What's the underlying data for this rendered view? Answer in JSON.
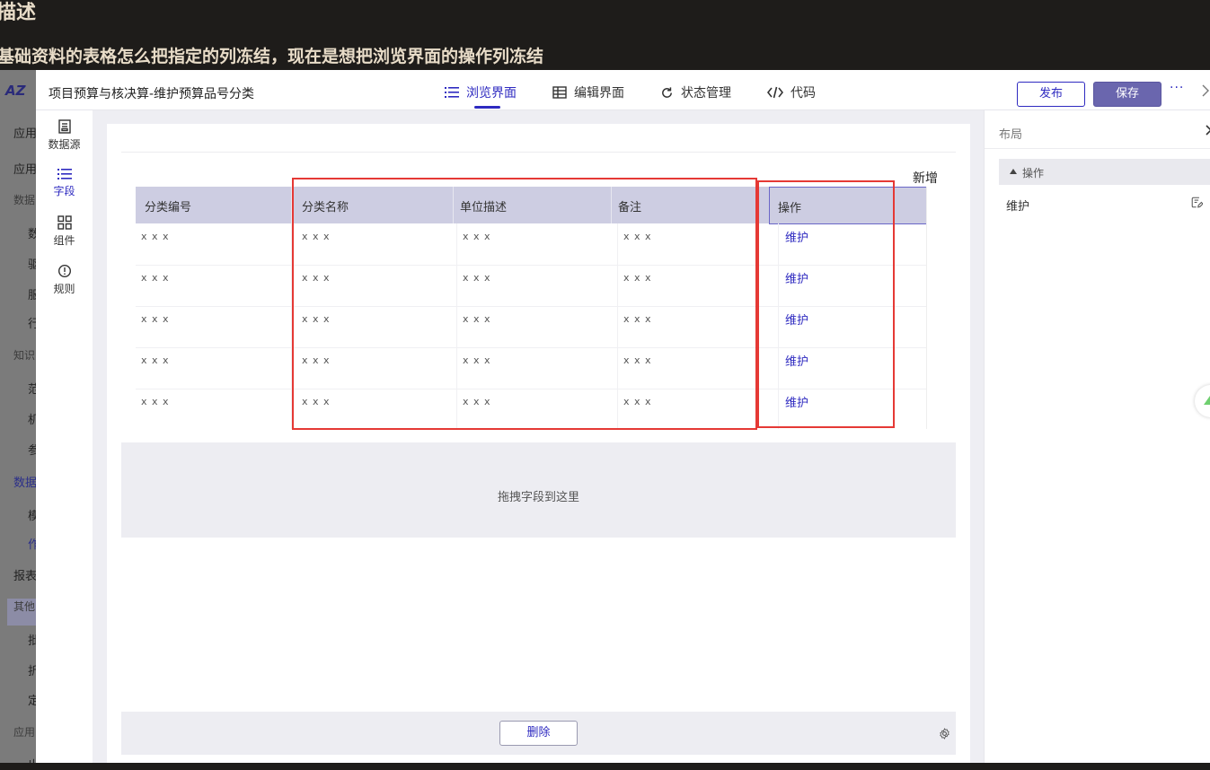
{
  "question": {
    "title": "描述",
    "body": "基础资料的表格怎么把指定的列冻结，现在是想把浏览界面的操作列冻结"
  },
  "background_sidebar": {
    "logo": "AZ",
    "items": [
      "应用",
      "应用",
      "数据",
      "数",
      "驱",
      "服",
      "行",
      "知识",
      "范",
      "机",
      "参",
      "数据",
      "模",
      "作",
      "报表",
      "其他",
      "批",
      "折",
      "定",
      "应用",
      "出"
    ]
  },
  "header": {
    "title": "项目预算与核决算-维护预算品号分类",
    "tabs": [
      {
        "label": "浏览界面",
        "icon": "list-icon",
        "active": true
      },
      {
        "label": "编辑界面",
        "icon": "table-icon",
        "active": false
      },
      {
        "label": "状态管理",
        "icon": "refresh-icon",
        "active": false
      },
      {
        "label": "代码",
        "icon": "code-icon",
        "active": false
      }
    ],
    "publish_label": "发布",
    "save_label": "保存",
    "more_label": "···"
  },
  "left_nav": [
    {
      "label": "数据源",
      "icon": "datasource-icon",
      "active": false
    },
    {
      "label": "字段",
      "icon": "fields-icon",
      "active": true
    },
    {
      "label": "组件",
      "icon": "components-icon",
      "active": false
    },
    {
      "label": "规则",
      "icon": "rules-icon",
      "active": false
    }
  ],
  "canvas": {
    "add_label": "新增",
    "table": {
      "columns": [
        "分类编号",
        "分类名称",
        "单位描述",
        "备注",
        "操作"
      ],
      "rows": [
        [
          "x x x",
          "x x x",
          "x x x",
          "x x x",
          "维护"
        ],
        [
          "x x x",
          "x x x",
          "x x x",
          "x x x",
          "维护"
        ],
        [
          "x x x",
          "x x x",
          "x x x",
          "x x x",
          "维护"
        ],
        [
          "x x x",
          "x x x",
          "x x x",
          "x x x",
          "维护"
        ],
        [
          "x x x",
          "x x x",
          "x x x",
          "x x x",
          "维护"
        ]
      ]
    },
    "dropzone_label": "拖拽字段到这里",
    "delete_label": "删除"
  },
  "right_panel": {
    "title": "布局",
    "group_label": "操作",
    "item_label": "维护"
  },
  "colors": {
    "accent": "#2e2ac0",
    "save_bg": "#6a66ae",
    "table_header": "#cdcde2",
    "annotation_red": "#e53935"
  }
}
